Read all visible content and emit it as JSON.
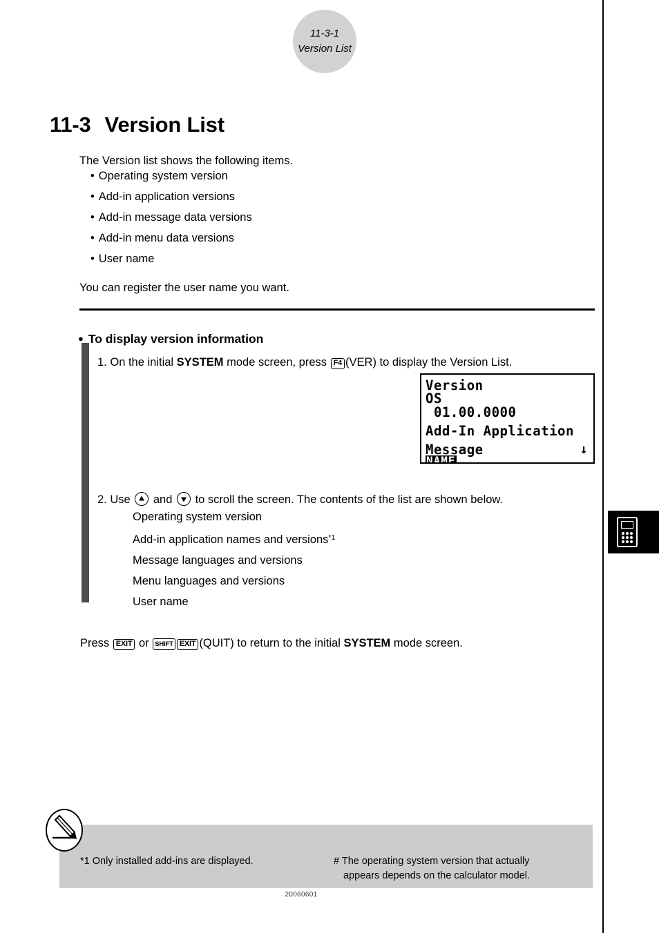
{
  "page": {
    "header_badge": {
      "line1": "11-3-1",
      "line2": "Version List"
    },
    "title": {
      "number": "11-3",
      "text": "Version List"
    },
    "footer_date": "20060601"
  },
  "intro": {
    "top": "The Version list shows the following items.",
    "bottom": "You can register the user name you want."
  },
  "feature_bullets": [
    {
      "dot": "•",
      "label": "Operating system version"
    },
    {
      "dot": "•",
      "label": "Add-in application versions"
    },
    {
      "dot": "•",
      "label": "Add-in message data versions"
    },
    {
      "dot": "•",
      "label": "Add-in menu data versions"
    },
    {
      "dot": "•",
      "label": "User name"
    }
  ],
  "procedure": {
    "heading_dot": "●",
    "heading": "To display version information",
    "step1": {
      "number": "1.",
      "part1": "On the initial ",
      "mode": "SYSTEM",
      "part2": " mode screen, press ",
      "key": "F4",
      "part3": "(VER) to display the Version List."
    },
    "step2": {
      "number": "2.",
      "part1": "Use ",
      "part2": " and ",
      "part3": " to scroll the screen. The contents of the list are shown below."
    },
    "contents": [
      {
        "label": "Operating system version",
        "note": ""
      },
      {
        "label": "Add-in application names and versions",
        "note": "*1"
      },
      {
        "label": "Message languages and versions",
        "note": ""
      },
      {
        "label": "Menu languages and versions",
        "note": ""
      },
      {
        "label": "User name",
        "note": ""
      }
    ],
    "press_line": {
      "part1": "Press ",
      "key1": "EXIT",
      "part2": " or ",
      "key2": "SHIFT",
      "key3": "EXIT",
      "part3": "(QUIT) to return to the initial ",
      "mode": "SYSTEM",
      "part4": " mode screen."
    }
  },
  "lcd_screen": {
    "row1": "Version",
    "row2": "OS",
    "row3": "01.00.0000",
    "row4": "Add-In Application",
    "row5": "Message",
    "scroll_indicator": "↓",
    "function_key": "NAME"
  },
  "footnotes": {
    "left": "*1 Only installed add-ins are displayed.",
    "right_line1": "# The operating system version that actually",
    "right_line2": "appears depends on the calculator model."
  },
  "colors": {
    "badge_gray": "#d2d2d2",
    "step_bar_gray": "#4d4d4d",
    "footnote_gray": "#cccccc",
    "ink": "#000000"
  }
}
